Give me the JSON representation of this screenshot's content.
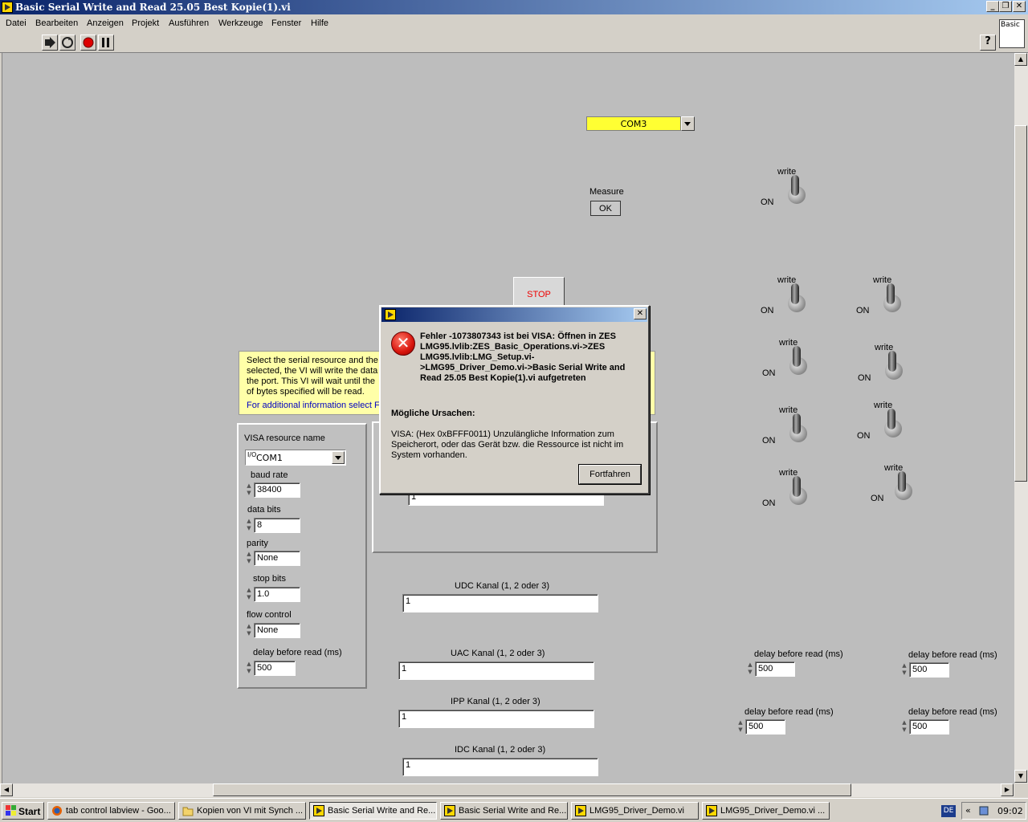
{
  "window": {
    "title": "Basic Serial Write and Read 25.05 Best Kopie(1).vi"
  },
  "menu": [
    "Datei",
    "Bearbeiten",
    "Anzeigen",
    "Projekt",
    "Ausführen",
    "Werkzeuge",
    "Fenster",
    "Hilfe"
  ],
  "toolbar": {
    "help": "?",
    "basic_label": "Basic"
  },
  "com_select": {
    "value": "COM3"
  },
  "measure": {
    "label": "Measure",
    "button": "OK"
  },
  "stop_button": "STOP",
  "description": {
    "lines": [
      "Select the serial resource and the",
      "selected, the VI will write the data",
      "the port.  This VI will wait until the",
      "of bytes specified will be read."
    ],
    "link": "For additional information select Fi"
  },
  "serial_config": {
    "visa_label": "VISA resource name",
    "visa_value": "COM1",
    "baud_label": "baud rate",
    "baud_value": "38400",
    "data_bits_label": "data bits",
    "data_bits_value": "8",
    "parity_label": "parity",
    "parity_value": "None",
    "stop_bits_label": "stop bits",
    "stop_bits_value": "1.0",
    "flow_label": "flow control",
    "flow_value": "None",
    "delay_label": "delay before read (ms)",
    "delay_value": "500"
  },
  "hidden_field_value": "1",
  "channels": [
    {
      "label": "UDC Kanal (1, 2 oder 3)",
      "value": "1"
    },
    {
      "label": "UAC Kanal (1, 2 oder 3)",
      "value": "1"
    },
    {
      "label": "IPP Kanal (1, 2 oder 3)",
      "value": "1"
    },
    {
      "label": "IDC Kanal (1, 2 oder 3)",
      "value": "1"
    }
  ],
  "toggles": {
    "write": "write",
    "on": "ON"
  },
  "delays": [
    {
      "label": "delay before read (ms)",
      "value": "500"
    },
    {
      "label": "delay before read (ms)",
      "value": "500"
    },
    {
      "label": "delay before read (ms)",
      "value": "500"
    },
    {
      "label": "delay before read (ms)",
      "value": "500"
    }
  ],
  "dialog": {
    "message": "Fehler -1073807343 ist bei VISA: Öffnen in ZES LMG95.lvlib:ZES_Basic_Operations.vi->ZES LMG95.lvlib:LMG_Setup.vi->LMG95_Driver_Demo.vi->Basic Serial Write and Read 25.05 Best Kopie(1).vi aufgetreten",
    "causes_heading": "Mögliche Ursachen:",
    "causes": "VISA:  (Hex 0xBFFF0011) Unzulängliche Information zum Speicherort, oder das Gerät bzw. die Ressource ist nicht im System vorhanden.",
    "button": "Fortfahren",
    "close": "✕"
  },
  "taskbar": {
    "start": "Start",
    "tasks": [
      "tab control labview - Goo...",
      "Kopien von VI mit Synch ...",
      "Basic Serial Write and Re...",
      "Basic Serial Write and Re...",
      "LMG95_Driver_Demo.vi",
      "LMG95_Driver_Demo.vi ..."
    ],
    "lang": "DE",
    "clock": "09:02"
  },
  "colors": {
    "title_start": "#0a246a",
    "title_end": "#a6caf0",
    "com_field": "#ffff33",
    "desc_bg": "#ffffa8",
    "error_red": "#d8150c"
  }
}
